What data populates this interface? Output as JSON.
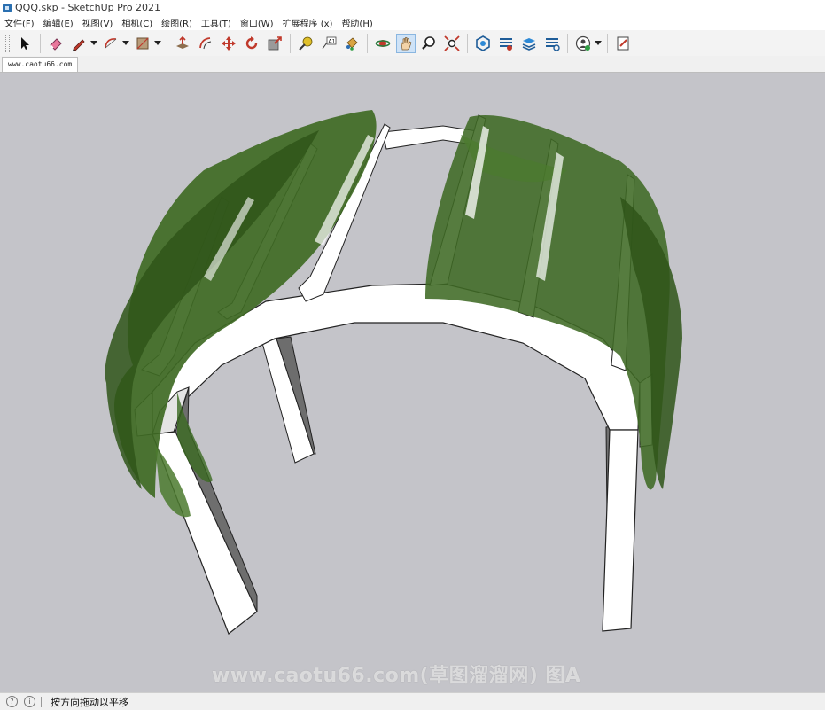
{
  "window": {
    "title": "QQQ.skp - SketchUp Pro 2021"
  },
  "menu": [
    "文件(F)",
    "编辑(E)",
    "视图(V)",
    "相机(C)",
    "绘图(R)",
    "工具(T)",
    "窗口(W)",
    "扩展程序 (x)",
    "帮助(H)"
  ],
  "toolbar": {
    "buttons": [
      {
        "icon": "select-arrow-icon"
      },
      {
        "icon": "eraser-icon"
      },
      {
        "icon": "pencil-line-icon",
        "dropdown": true
      },
      {
        "icon": "arc-icon",
        "dropdown": true
      },
      {
        "icon": "rectangle-icon",
        "dropdown": true
      },
      {
        "icon": "push-pull-icon"
      },
      {
        "icon": "offset-icon"
      },
      {
        "icon": "move-icon"
      },
      {
        "icon": "rotate-icon"
      },
      {
        "icon": "scale-icon"
      },
      {
        "icon": "tape-measure-icon"
      },
      {
        "icon": "text-label-icon"
      },
      {
        "icon": "paint-bucket-icon"
      },
      {
        "icon": "orbit-icon"
      },
      {
        "icon": "pan-hand-icon",
        "active": true
      },
      {
        "icon": "zoom-icon"
      },
      {
        "icon": "zoom-extents-icon"
      },
      {
        "icon": "warehouse-icon"
      },
      {
        "icon": "extension-warehouse-icon"
      },
      {
        "icon": "layout-icon"
      },
      {
        "icon": "extension-manager-icon"
      },
      {
        "icon": "account-icon",
        "dropdown": true
      },
      {
        "icon": "send-to-layout-icon"
      }
    ]
  },
  "tabs": [
    {
      "label": "www.caotu66.com"
    }
  ],
  "viewport": {
    "background": "#c4c4c9"
  },
  "watermark": {
    "text": "www.caotu66.com(草图溜溜网) 图A"
  },
  "status": {
    "text": "按方向拖动以平移"
  }
}
